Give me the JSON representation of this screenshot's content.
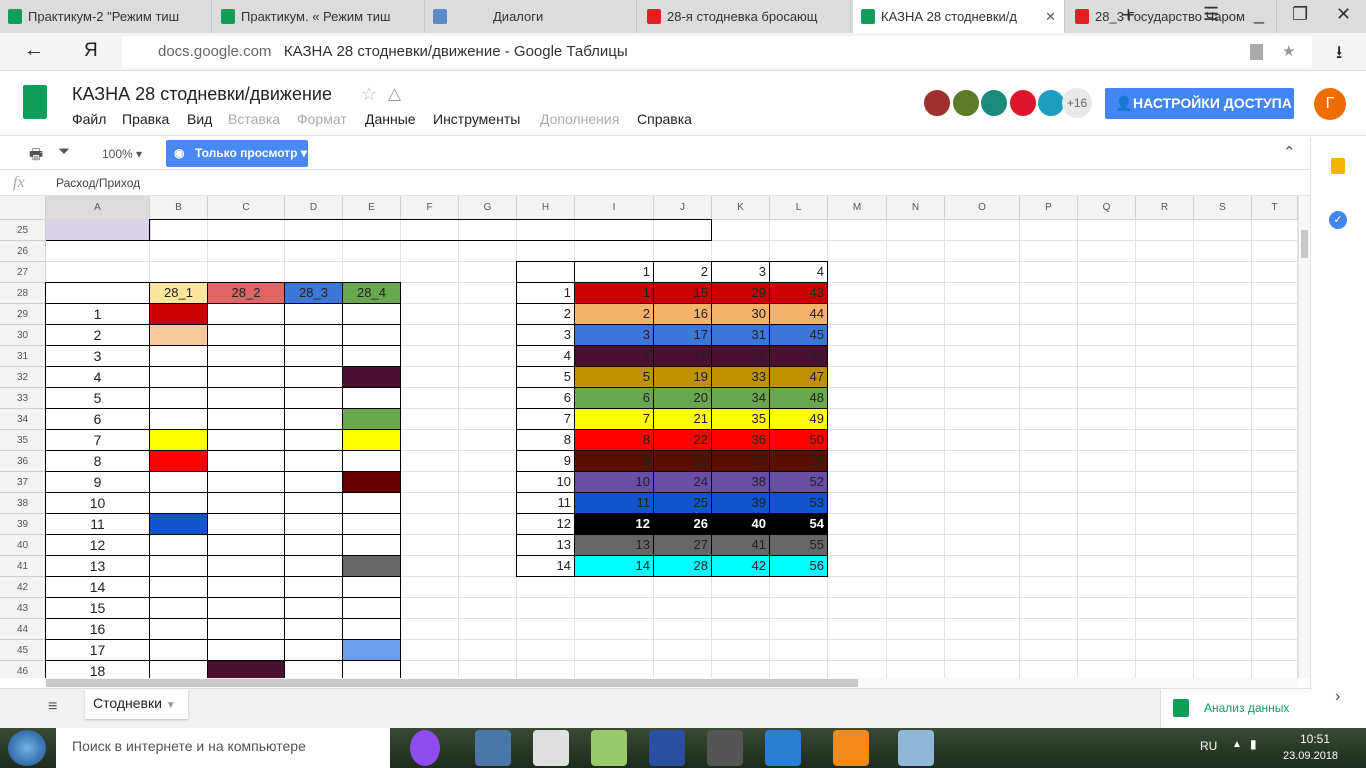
{
  "browser": {
    "tabs": [
      {
        "label": "Практикум-2 \"Режим тиш",
        "icon": "sheets-icon",
        "color": "#0f9d58"
      },
      {
        "label": "Практикум. « Режим тиш",
        "icon": "sheets-icon",
        "color": "#0f9d58"
      },
      {
        "label": "Диалоги",
        "icon": "chat-icon",
        "color": "#5b88c8"
      },
      {
        "label": "28-я стодневка бросающ",
        "icon": "red-stop-icon",
        "color": "#e02020"
      },
      {
        "label": "КАЗНА 28 стодневки/д",
        "icon": "sheets-icon",
        "color": "#0f9d58",
        "active": true
      },
      {
        "label": "28_3 Государство Чаром",
        "icon": "red-stop-icon",
        "color": "#e02020"
      }
    ],
    "new_tab": "+",
    "back": "←",
    "yandex": "Я",
    "url_domain": "docs.google.com",
    "url_title": "КАЗНА 28 стодневки/движение - Google Таблицы"
  },
  "doc": {
    "title": "КАЗНА 28 стодневки/движение",
    "menu": [
      {
        "label": "Файл",
        "disabled": false
      },
      {
        "label": "Правка",
        "disabled": false
      },
      {
        "label": "Вид",
        "disabled": false
      },
      {
        "label": "Вставка",
        "disabled": true
      },
      {
        "label": "Формат",
        "disabled": true
      },
      {
        "label": "Данные",
        "disabled": false
      },
      {
        "label": "Инструменты",
        "disabled": false
      },
      {
        "label": "Дополнения",
        "disabled": true
      },
      {
        "label": "Справка",
        "disabled": false
      }
    ],
    "collaborators": [
      "#a0302e",
      "#5d7a2a",
      "#1a8a7a",
      "#e0142a",
      "#1b9ec0"
    ],
    "more_collaborators": "+16",
    "share_label": "НАСТРОЙКИ ДОСТУПА",
    "user_initial": "Г"
  },
  "toolbar": {
    "zoom": "100%",
    "view_only": "Только просмотр"
  },
  "formula_bar": {
    "fx": "fx",
    "value": "Расход/Приход"
  },
  "grid": {
    "columns": [
      "A",
      "B",
      "C",
      "D",
      "E",
      "F",
      "G",
      "H",
      "I",
      "J",
      "K",
      "L",
      "M",
      "N",
      "O",
      "P",
      "Q",
      "R",
      "S",
      "T"
    ],
    "rows": [
      25,
      26,
      27,
      28,
      29,
      30,
      31,
      32,
      33,
      34,
      35,
      36,
      37,
      38,
      39,
      40,
      41,
      42,
      43,
      44,
      45,
      46
    ],
    "a25_color": "#d9d2e9",
    "left_table": {
      "headers": [
        {
          "label": "28_1",
          "color": "#ffe599"
        },
        {
          "label": "28_2",
          "color": "#e06666"
        },
        {
          "label": "28_3",
          "color": "#3c78d8"
        },
        {
          "label": "28_4",
          "color": "#6aa84f"
        }
      ],
      "numbers": [
        "1",
        "2",
        "3",
        "4",
        "5",
        "6",
        "7",
        "8",
        "9",
        "10",
        "11",
        "12",
        "13",
        "14",
        "15",
        "16",
        "17",
        "18"
      ],
      "fills": [
        {
          "cell": "B29",
          "color": "#cc0000"
        },
        {
          "cell": "B30",
          "color": "#f9cb9c"
        },
        {
          "cell": "E32",
          "color": "#4c1130"
        },
        {
          "cell": "E34",
          "color": "#6aa84f"
        },
        {
          "cell": "B35",
          "color": "#ffff00"
        },
        {
          "cell": "E35",
          "color": "#ffff00"
        },
        {
          "cell": "B36",
          "color": "#ff0000"
        },
        {
          "cell": "E37",
          "color": "#660000"
        },
        {
          "cell": "B39",
          "color": "#1155cc"
        },
        {
          "cell": "E41",
          "color": "#666666"
        },
        {
          "cell": "E45",
          "color": "#6d9eeb"
        },
        {
          "cell": "C46",
          "color": "#4c1130"
        }
      ]
    },
    "right_table": {
      "headers": [
        "1",
        "2",
        "3",
        "4"
      ],
      "rows": [
        {
          "label": "1",
          "color": "#cc0000",
          "values": [
            "1",
            "15",
            "29",
            "43"
          ]
        },
        {
          "label": "2",
          "color": "#f6b26b",
          "values": [
            "2",
            "16",
            "30",
            "44"
          ]
        },
        {
          "label": "3",
          "color": "#3c78d8",
          "values": [
            "3",
            "17",
            "31",
            "45"
          ]
        },
        {
          "label": "4",
          "color": "#4c1130",
          "values": [
            "4",
            "18",
            "32",
            "46"
          ]
        },
        {
          "label": "5",
          "color": "#bf9000",
          "values": [
            "5",
            "19",
            "33",
            "47"
          ]
        },
        {
          "label": "6",
          "color": "#6aa84f",
          "values": [
            "6",
            "20",
            "34",
            "48"
          ]
        },
        {
          "label": "7",
          "color": "#ffff00",
          "values": [
            "7",
            "21",
            "35",
            "49"
          ]
        },
        {
          "label": "8",
          "color": "#ff0000",
          "values": [
            "8",
            "22",
            "36",
            "50"
          ]
        },
        {
          "label": "9",
          "color": "#5b0f00",
          "values": [
            "9",
            "23",
            "37",
            "51"
          ]
        },
        {
          "label": "10",
          "color": "#674ea7",
          "values": [
            "10",
            "24",
            "38",
            "52"
          ]
        },
        {
          "label": "11",
          "color": "#1155cc",
          "values": [
            "11",
            "25",
            "39",
            "53"
          ]
        },
        {
          "label": "12",
          "color": "#000000",
          "text_color": "#ffffff",
          "values": [
            "12",
            "26",
            "40",
            "54"
          ]
        },
        {
          "label": "13",
          "color": "#666666",
          "values": [
            "13",
            "27",
            "41",
            "55"
          ]
        },
        {
          "label": "14",
          "color": "#00ffff",
          "values": [
            "14",
            "28",
            "42",
            "56"
          ]
        }
      ]
    }
  },
  "sheet_tabs": [
    {
      "label": "Стодневки",
      "active": true
    }
  ],
  "explore_label": "Анализ данных",
  "taskbar": {
    "search_placeholder": "Поиск в интернете и на компьютере",
    "lang": "RU",
    "time": "10:51",
    "date": "23.09.2018",
    "apps": [
      {
        "icon": "alice-mic-icon",
        "color": "#8f4df0"
      },
      {
        "icon": "vk-icon",
        "color": "#4a76a8"
      },
      {
        "icon": "yandex-browser-icon",
        "color": "#e0e0e0"
      },
      {
        "icon": "sticky-notes-icon",
        "color": "#9ac96b"
      },
      {
        "icon": "save-icon",
        "color": "#2a4fa0"
      },
      {
        "icon": "recorder-icon",
        "color": "#555555"
      },
      {
        "icon": "internet-explorer-icon",
        "color": "#2a7fd4"
      },
      {
        "icon": "odnoklassniki-icon",
        "color": "#f28b1c"
      },
      {
        "icon": "calculator-icon",
        "color": "#8fb8d8"
      }
    ]
  }
}
